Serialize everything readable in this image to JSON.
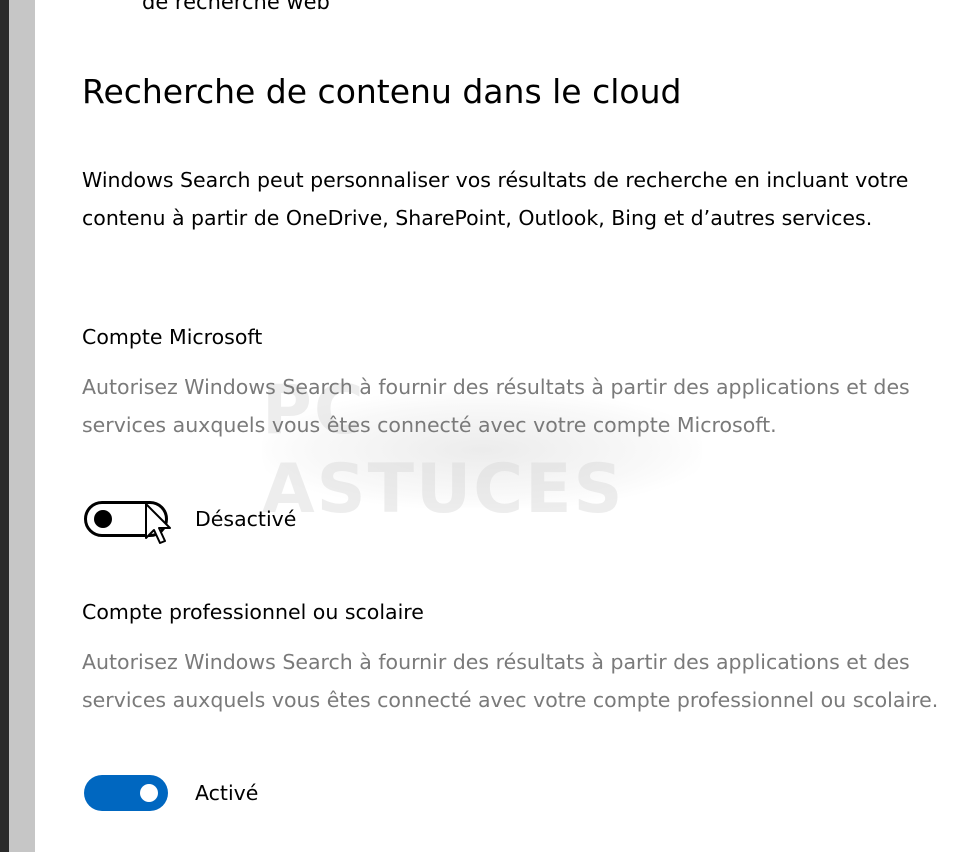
{
  "colors": {
    "accent": "#0067c0",
    "secondary_text": "#7a7a7a",
    "rail": "#c6c6c6"
  },
  "previous_section": {
    "partial_text": "de recherche web"
  },
  "watermark": {
    "text": "PC ASTUCES"
  },
  "section": {
    "title": "Recherche de contenu dans le cloud",
    "intro": "Windows Search peut personnaliser vos résultats de recherche en incluant votre contenu à partir de OneDrive, SharePoint, Outlook, Bing et d’autres services."
  },
  "microsoft_account": {
    "heading": "Compte Microsoft",
    "description": "Autorisez Windows Search à fournir des résultats à partir des applications et des services auxquels vous êtes connecté avec votre compte Microsoft.",
    "toggle_on": false,
    "toggle_label": "Désactivé"
  },
  "work_account": {
    "heading": "Compte professionnel ou scolaire",
    "description": "Autorisez Windows Search à fournir des résultats à partir des applications et des services auxquels vous êtes connecté avec votre compte professionnel ou scolaire.",
    "toggle_on": true,
    "toggle_label": "Activé"
  },
  "icons": {
    "cursor": "mouse-pointer-icon"
  }
}
